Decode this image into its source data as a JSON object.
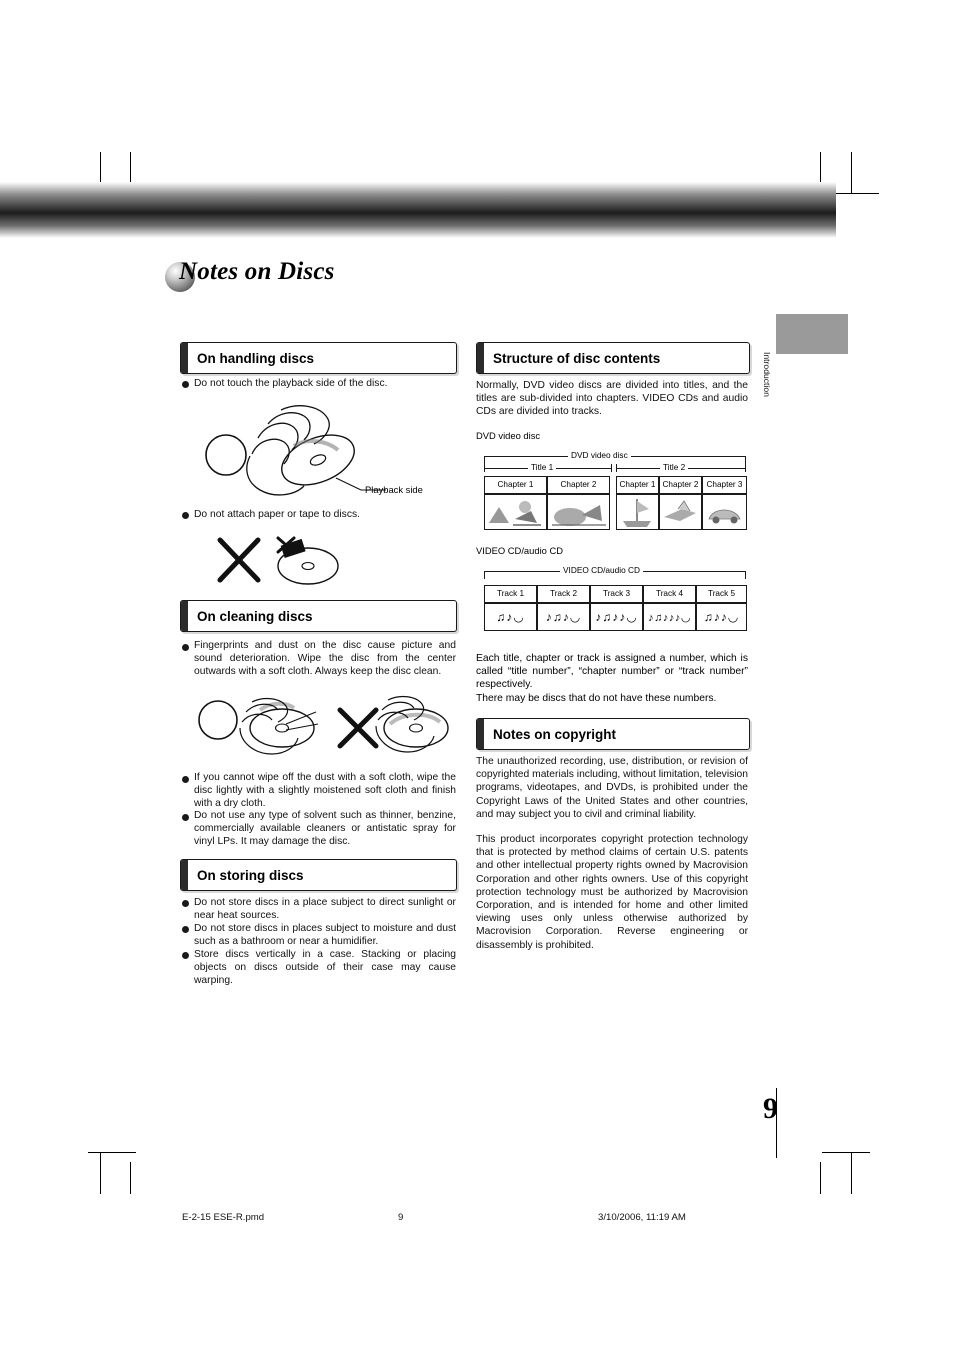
{
  "document": {
    "title": "Notes on Discs",
    "page_number": "9",
    "side_tab_label": "Introduction",
    "footer": {
      "filename": "E-2-15 ESE-R.pmd",
      "page": "9",
      "timestamp": "3/10/2006, 11:19 AM"
    }
  },
  "left_column": {
    "sections": [
      {
        "heading": "On handling discs",
        "bullets": [
          "Do not touch the playback side of the disc.",
          "Do not attach paper or tape to discs."
        ],
        "figure_labels": [
          "Playback side"
        ]
      },
      {
        "heading": "On cleaning discs",
        "bullets": [
          "Fingerprints and dust on the disc cause picture and sound deterioration. Wipe the disc from the center outwards with a soft cloth. Always keep the disc clean.",
          "If you cannot wipe off the dust with a soft cloth, wipe the disc lightly with a slightly moistened soft cloth and finish with a dry cloth.",
          "Do not use any type of solvent such as thinner, benzine, commercially available cleaners or antistatic spray for vinyl LPs. It may damage the disc."
        ]
      },
      {
        "heading": "On storing discs",
        "bullets": [
          "Do not store discs in a place subject to direct sunlight or near heat sources.",
          "Do not store discs in places subject to moisture and dust such as a bathroom or near a humidifier.",
          "Store discs vertically in a case. Stacking or placing objects on discs outside of their case may cause warping."
        ]
      }
    ]
  },
  "right_column": {
    "sections": [
      {
        "heading": "Structure of disc contents",
        "intro": "Normally, DVD video discs are divided into titles, and the titles are sub-divided into chapters. VIDEO CDs and audio CDs are divided into tracks.",
        "dvd_caption": "DVD video disc",
        "vcd_caption": "VIDEO CD/audio CD",
        "closing": "Each title, chapter or track is assigned a number, which is called “title number”, “chapter number” or “track number” respectively.\nThere may be discs that do not have these numbers."
      },
      {
        "heading": "Notes on copyright",
        "paragraphs": [
          "The unauthorized recording, use, distribution, or revision of copyrighted materials including, without limitation, television programs, videotapes, and DVDs, is prohibited under the Copyright Laws of the United States and other countries, and may subject you to civil and criminal liability.",
          "This product incorporates copyright protection technology that is protected by method claims of certain U.S. patents and other intellectual property rights owned by Macrovision Corporation and other rights owners. Use of this copyright protection technology must be authorized by Macrovision Corporation, and is intended for home and other limited viewing uses only unless otherwise authorized by Macrovision Corporation. Reverse engineering or disassembly is prohibited."
        ]
      }
    ]
  },
  "dvd_diagram": {
    "top_label": "DVD video disc",
    "titles": [
      "Title 1",
      "Title 2"
    ],
    "chapters": [
      "Chapter 1",
      "Chapter 2",
      "Chapter 1",
      "Chapter 2",
      "Chapter 3"
    ]
  },
  "vcd_diagram": {
    "top_label": "VIDEO CD/audio CD",
    "tracks": [
      "Track 1",
      "Track 2",
      "Track 3",
      "Track 4",
      "Track 5"
    ],
    "note_glyphs": [
      "♫♪◡",
      "♪♫♪◡",
      "♪♫♪♪◡",
      "♪♫♪♪♪◡",
      "♫♪♪◡"
    ]
  }
}
